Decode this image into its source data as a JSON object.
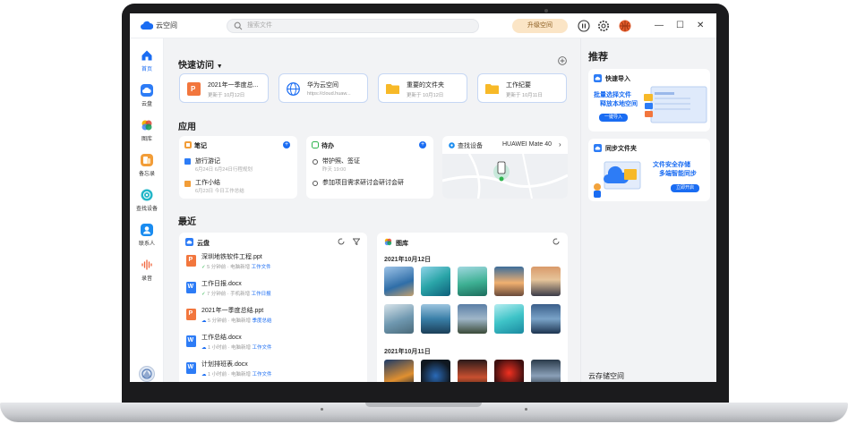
{
  "app": {
    "name": "云空间"
  },
  "search": {
    "placeholder": "搜索文件"
  },
  "header": {
    "upgrade_label": "升级空间"
  },
  "window": {
    "minimize": "—",
    "maximize": "☐",
    "close": "✕"
  },
  "nav": [
    {
      "label": "首页"
    },
    {
      "label": "云盘"
    },
    {
      "label": "图库"
    },
    {
      "label": "备忘录"
    },
    {
      "label": "查找设备"
    },
    {
      "label": "联系人"
    },
    {
      "label": "录音"
    }
  ],
  "quick_access": {
    "title": "快速访问",
    "items": [
      {
        "title": "2021年一季度总...",
        "sub": "更新于 10月12日"
      },
      {
        "title": "华为云空间",
        "sub": "https://cloud.huaw..."
      },
      {
        "title": "重要的文件夹",
        "sub": "更新于 10月12日"
      },
      {
        "title": "工作纪要",
        "sub": "更新于 10月11日"
      }
    ]
  },
  "apps": {
    "title": "应用",
    "notes": {
      "title": "笔记",
      "items": [
        {
          "title": "旅行游记",
          "sub": "6月24日  6月24日行程规划"
        },
        {
          "title": "工作小结",
          "sub": "6月23日  今日工作总结"
        }
      ]
    },
    "todo": {
      "title": "待办",
      "items": [
        {
          "title": "带护照、签证",
          "sub": "昨天 19:00"
        },
        {
          "title": "参加项目需求研讨会研讨会研",
          "sub": ""
        }
      ]
    },
    "find_device": {
      "title": "查找设备",
      "device": "HUAWEI Mate 40"
    }
  },
  "recent": {
    "title": "最近",
    "drive": {
      "title": "云盘",
      "files": [
        {
          "name": "深圳地铁软件工程.ppt",
          "meta": "5 分钟前  ·  电脑新增",
          "folder": "工作文件"
        },
        {
          "name": "工作日报.docx",
          "meta": "7 分钟前  ·  手机新增",
          "folder": "工作日报"
        },
        {
          "name": "2021年一季度总结.ppt",
          "meta": "5 分钟前  ·  电脑新增",
          "folder": "季度总结"
        },
        {
          "name": "工作总结.docx",
          "meta": "1 小时前  ·  电脑新增",
          "folder": "工作文件"
        },
        {
          "name": "计划排班表.docx",
          "meta": "1 小时前  ·  电脑新增",
          "folder": "工作文件"
        }
      ]
    },
    "gallery": {
      "title": "图库",
      "date1": "2021年10月12日",
      "date2": "2021年10月11日"
    }
  },
  "recommend": {
    "title": "推荐",
    "card1": {
      "title": "快速导入",
      "text1": "批量选择文件",
      "text2": "释放本地空间",
      "btn": "一键导入"
    },
    "card2": {
      "title": "同步文件夹",
      "text1": "文件安全存储",
      "text2": "多端智能同步",
      "btn": "立即开启"
    },
    "storage_title": "云存储空间"
  }
}
